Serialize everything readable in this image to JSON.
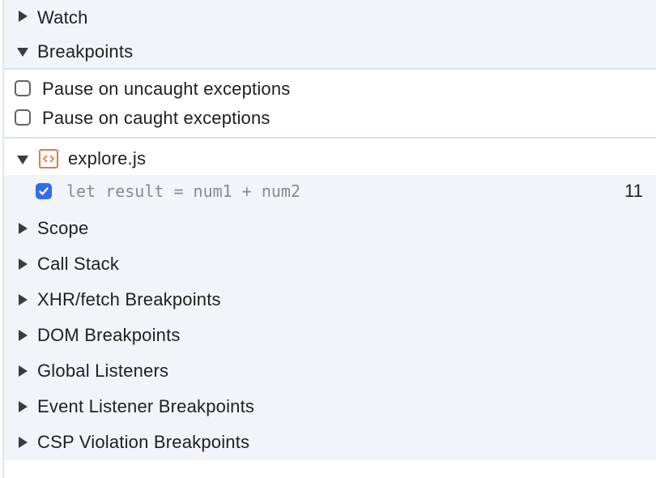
{
  "sections": {
    "watch": "Watch",
    "breakpoints": "Breakpoints",
    "scope": "Scope",
    "call_stack": "Call Stack",
    "xhr_fetch": "XHR/fetch Breakpoints",
    "dom": "DOM Breakpoints",
    "global_listeners": "Global Listeners",
    "event_listener": "Event Listener Breakpoints",
    "csp_violation": "CSP Violation Breakpoints"
  },
  "exceptions": {
    "uncaught": "Pause on uncaught exceptions",
    "caught": "Pause on caught exceptions"
  },
  "breakpoint_file": {
    "name": "explore.js",
    "icon": "js-file-icon",
    "entries": [
      {
        "code": "let result = num1 + num2",
        "line": "11",
        "checked": true
      }
    ]
  },
  "colors": {
    "section_background": "#f1f4f9",
    "divider": "#d6e2f0",
    "checkbox_checked": "#2f6ee4",
    "file_icon": "#e27b3d"
  }
}
